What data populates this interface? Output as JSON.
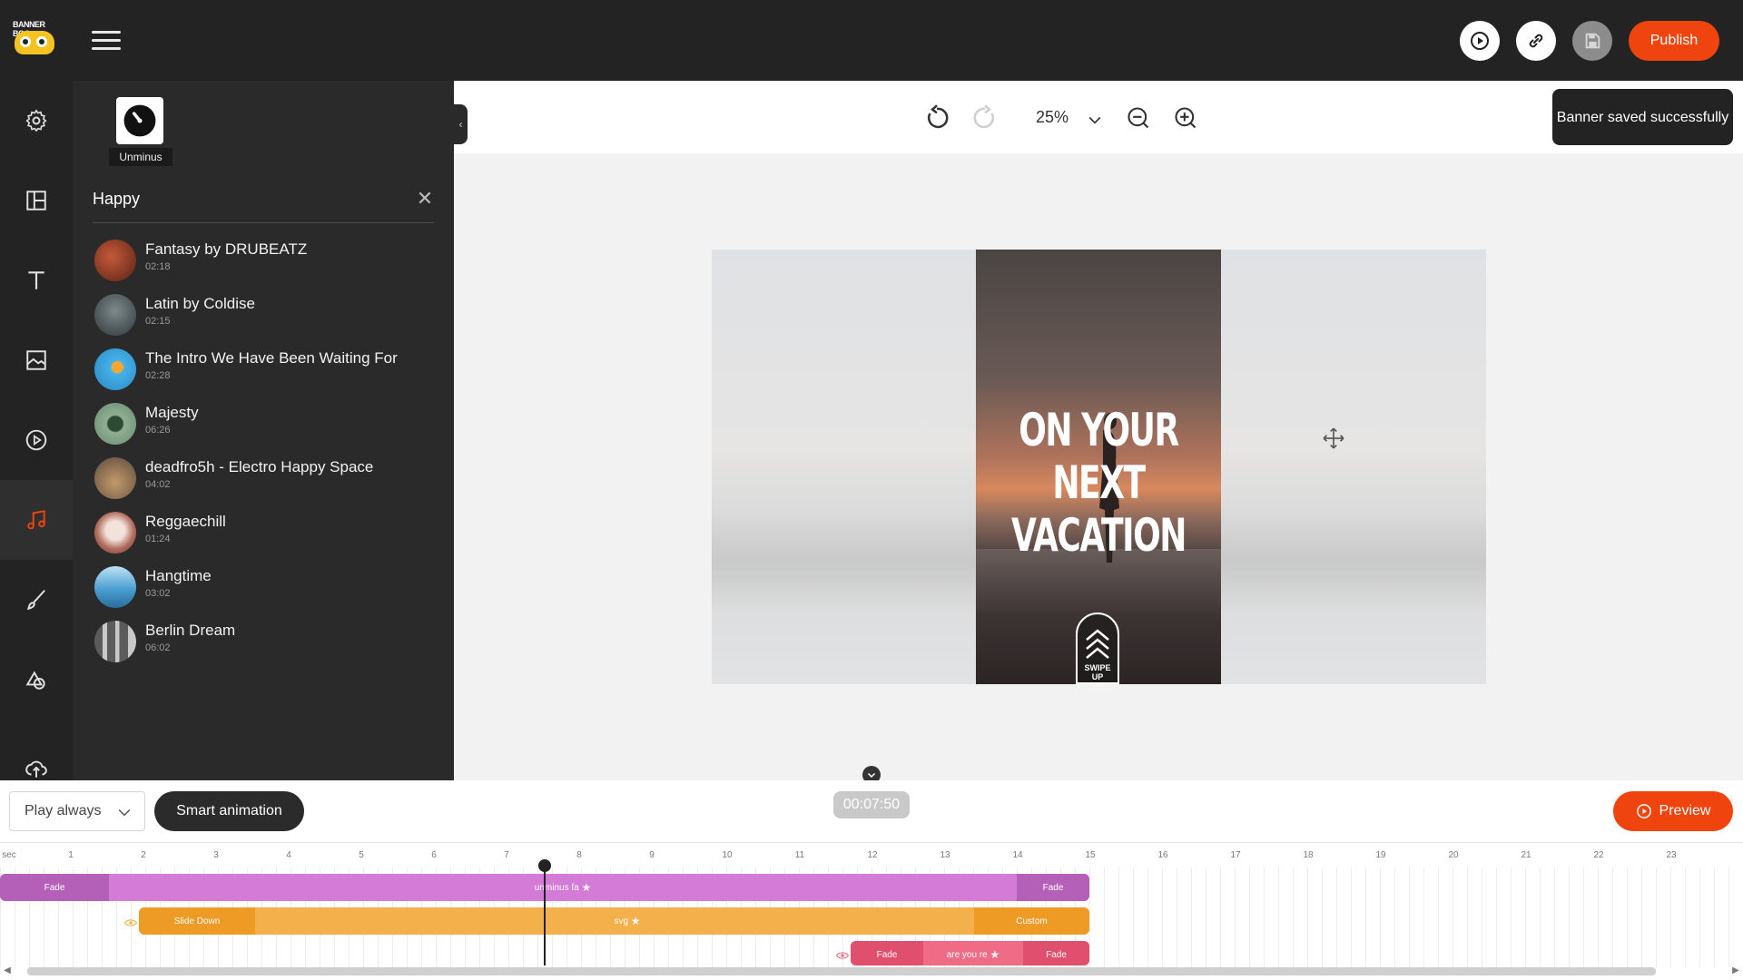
{
  "app": {
    "logo_text": "BANNER BOO",
    "publish_label": "Publish"
  },
  "sidebar": {
    "artist": {
      "name": "Unminus"
    },
    "category_title": "Happy",
    "tracks": [
      {
        "name": "Fantasy by DRUBEATZ",
        "duration": "02:18",
        "color": "#7a3a26"
      },
      {
        "name": "Latin by Coldise",
        "duration": "02:15",
        "color": "#445156"
      },
      {
        "name": "The Intro We Have Been Waiting For",
        "duration": "02:28",
        "color": "#3ea3d6"
      },
      {
        "name": "Majesty",
        "duration": "06:26",
        "color": "#6f8f73"
      },
      {
        "name": "deadfro5h - Electro Happy Space",
        "duration": "04:02",
        "color": "#8a7966"
      },
      {
        "name": "Reggaechill",
        "duration": "01:24",
        "color": "#c9a39a"
      },
      {
        "name": "Hangtime",
        "duration": "03:02",
        "color": "#3f86b8"
      },
      {
        "name": "Berlin Dream",
        "duration": "06:02",
        "color": "#8b8b8b"
      }
    ]
  },
  "canvas": {
    "zoom": "25%",
    "toast": "Banner saved successfully",
    "headline_line1": "ON YOUR NEXT",
    "headline_line2": "VACATION",
    "swipe_line1": "SWIPE",
    "swipe_line2": "UP"
  },
  "timeline": {
    "play_mode": "Play always",
    "smart_animation_label": "Smart animation",
    "current_time": "00:07:50",
    "preview_label": "Preview",
    "ruler_unit": "sec",
    "ruler_ticks": [
      "1",
      "2",
      "3",
      "4",
      "5",
      "6",
      "7",
      "8",
      "9",
      "10",
      "11",
      "12",
      "13",
      "14",
      "15",
      "16",
      "17",
      "18",
      "19",
      "20",
      "21",
      "22",
      "23"
    ],
    "layers": [
      {
        "in_label": "Fade",
        "name": "unminus fa",
        "out_label": "Fade",
        "color": "#d37bd6",
        "edge_color": "#b45fb8"
      },
      {
        "in_label": "Slide Down",
        "name": "svg",
        "out_label": "Custom",
        "color": "#f4b04a",
        "edge_color": "#ee9b25"
      },
      {
        "in_label": "Fade",
        "name": "are you re",
        "out_label": "Fade",
        "color": "#f06b86",
        "edge_color": "#e04f6d"
      }
    ]
  },
  "colors": {
    "accent": "#f0440f",
    "dark": "#232323",
    "panel": "#2a2a2a"
  }
}
